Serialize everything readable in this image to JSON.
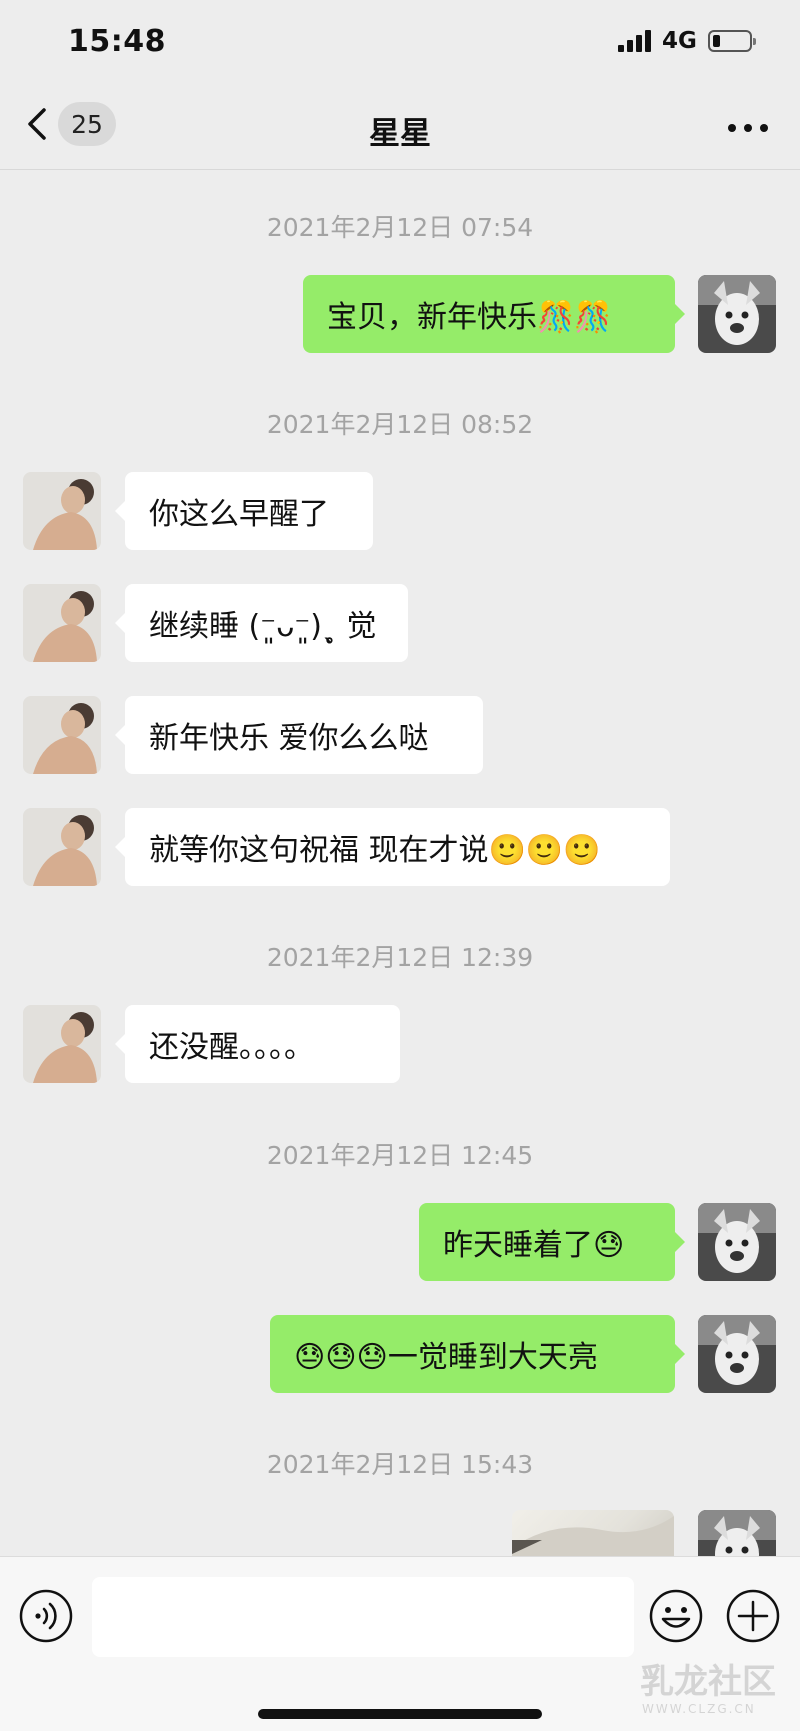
{
  "status_bar": {
    "time": "15:48",
    "network": "4G",
    "battery_level": 0.2
  },
  "nav": {
    "unread_count": "25",
    "title": "星星",
    "back_icon": "chevron-left-icon",
    "more_icon": "more-horizontal-icon"
  },
  "messages": [
    {
      "type": "timestamp",
      "text": "2021年2月12日 07:54"
    },
    {
      "type": "message",
      "side": "out",
      "text": "宝贝，新年快乐🎊🎊"
    },
    {
      "type": "timestamp",
      "text": "2021年2月12日 08:52"
    },
    {
      "type": "message",
      "side": "in",
      "text": "你这么早醒了"
    },
    {
      "type": "message",
      "side": "in",
      "text": "继续睡 (⁻͈ᴗ⁻͈)ˎ̥ 觉"
    },
    {
      "type": "message",
      "side": "in",
      "text": "新年快乐 爱你么么哒"
    },
    {
      "type": "message",
      "side": "in",
      "text": "就等你这句祝福 现在才说🙂🙂🙂"
    },
    {
      "type": "timestamp",
      "text": "2021年2月12日 12:39"
    },
    {
      "type": "message",
      "side": "in",
      "text": "还没醒。。。。"
    },
    {
      "type": "timestamp",
      "text": "2021年2月12日 12:45"
    },
    {
      "type": "message",
      "side": "out",
      "text": "昨天睡着了😓"
    },
    {
      "type": "message",
      "side": "out",
      "text": "😓😓😓一觉睡到大天亮"
    },
    {
      "type": "timestamp",
      "text": "2021年2月12日 15:43"
    },
    {
      "type": "image",
      "side": "out"
    }
  ],
  "input_bar": {
    "voice_icon": "voice-icon",
    "emoji_icon": "emoji-icon",
    "plus_icon": "plus-icon",
    "message_value": ""
  },
  "watermark": {
    "text": "乳龙社区",
    "subtext": "WWW.CLZG.CN"
  }
}
